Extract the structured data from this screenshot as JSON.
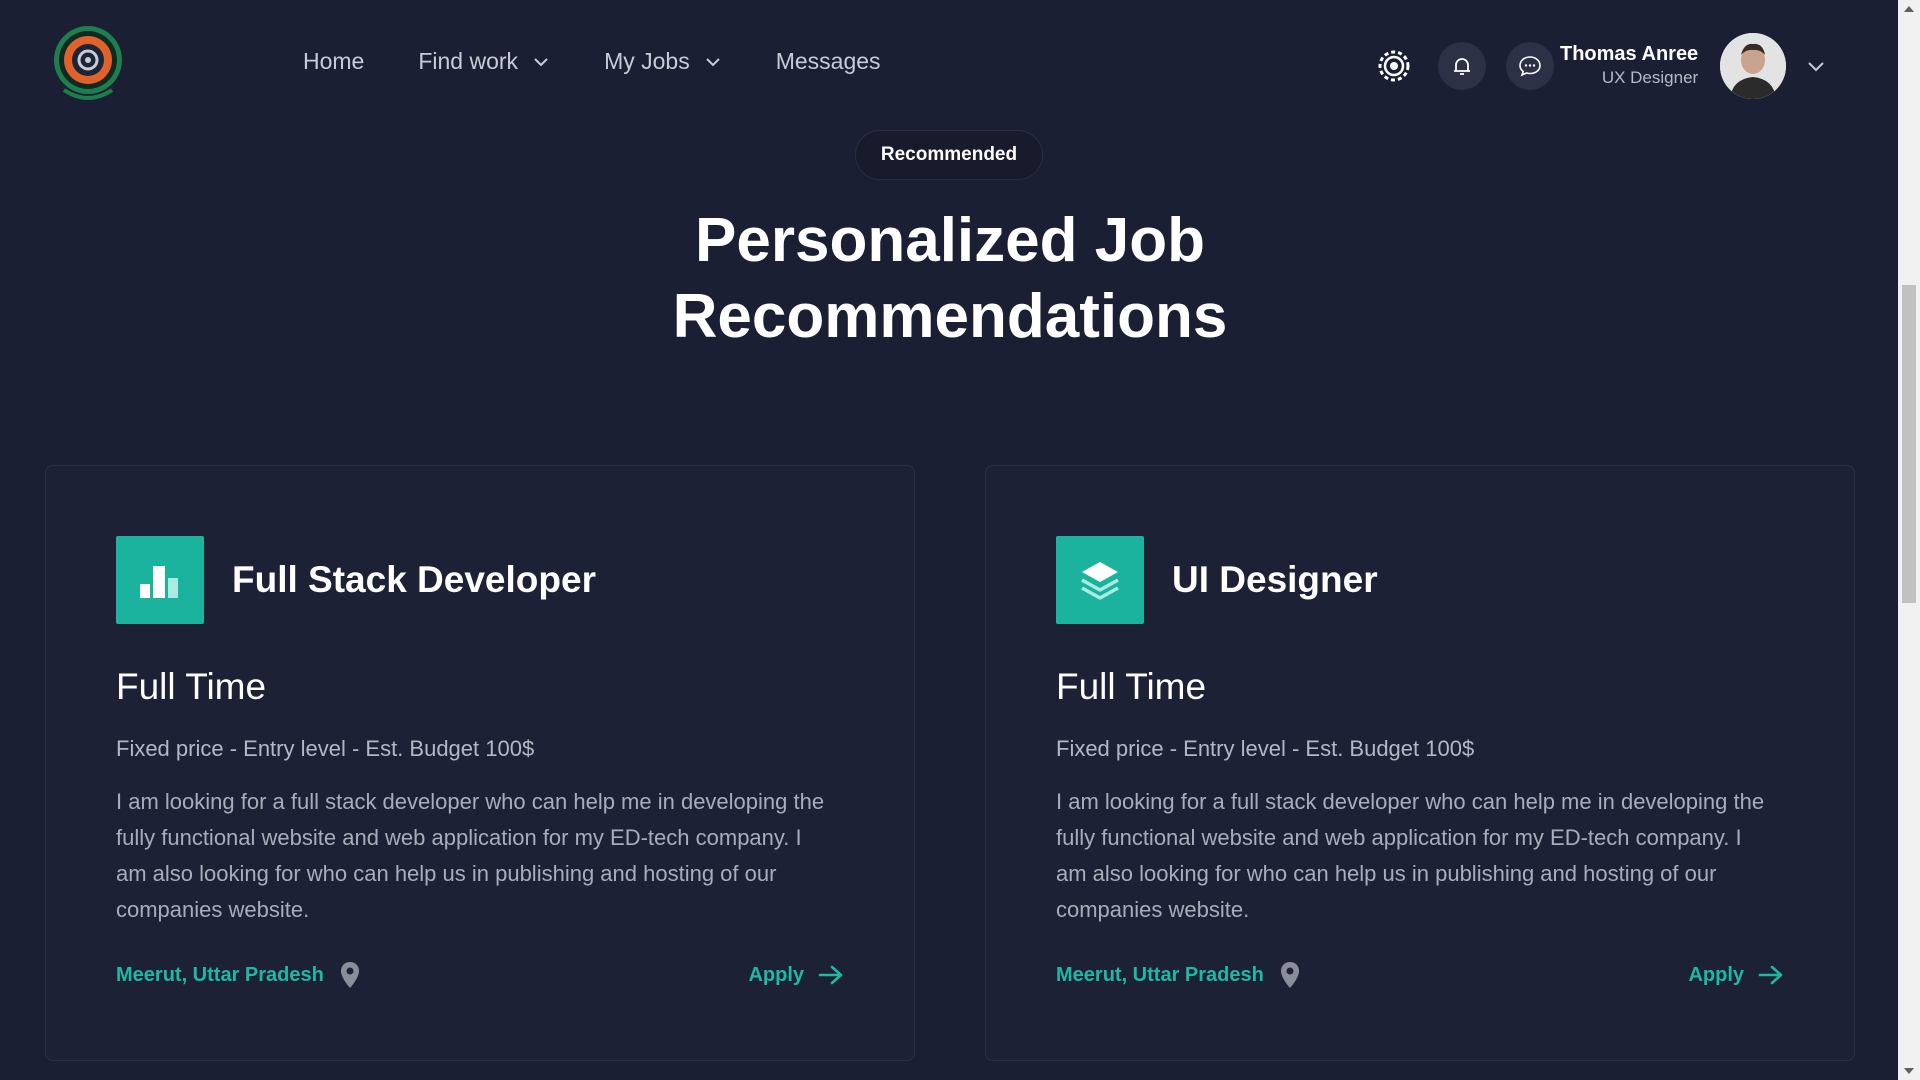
{
  "nav": {
    "items": [
      {
        "label": "Home",
        "has_dropdown": false
      },
      {
        "label": "Find work",
        "has_dropdown": true
      },
      {
        "label": "My Jobs",
        "has_dropdown": true
      },
      {
        "label": "Messages",
        "has_dropdown": false
      }
    ],
    "icons": [
      "settings-icon",
      "bell-icon",
      "chat-icon"
    ]
  },
  "profile": {
    "name": "Thomas Anree",
    "role": "UX Designer"
  },
  "hero": {
    "badge": "Recommended",
    "title": "Personalized Job Recommendations"
  },
  "cards": [
    {
      "icon": "bar-chart-icon",
      "title": "Full Stack Developer",
      "type": "Full Time",
      "meta": "Fixed price - Entry level - Est. Budget 100$",
      "description": "I am looking for a full stack developer who can help me in developing the fully functional website and web application for my ED-tech company. I am also looking for who can help us in publishing and hosting of our companies website.",
      "location": "Meerut, Uttar Pradesh",
      "apply_label": "Apply"
    },
    {
      "icon": "layers-icon",
      "title": "UI Designer",
      "type": "Full Time",
      "meta": "Fixed price - Entry level - Est. Budget 100$",
      "description": "I am looking for a full stack developer who can help me in developing the fully functional website and web application for my ED-tech company. I am also looking for who can help us in publishing and hosting of our companies website.",
      "location": "Meerut, Uttar Pradesh",
      "apply_label": "Apply"
    }
  ],
  "colors": {
    "background": "#1b1f33",
    "card_background": "#1d2135",
    "accent": "#1bb39d",
    "accent_text": "#1fb8a2"
  }
}
